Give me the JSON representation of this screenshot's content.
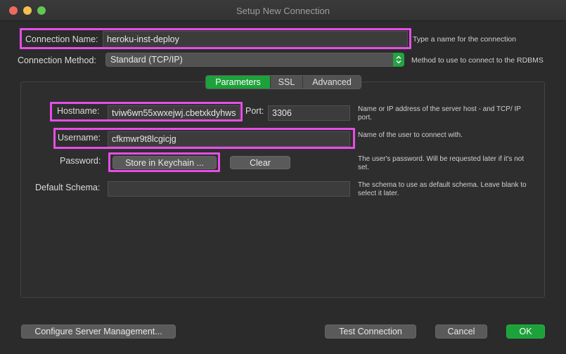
{
  "window": {
    "title": "Setup New Connection"
  },
  "connection_name": {
    "label": "Connection Name:",
    "value": "heroku-inst-deploy",
    "help": "Type a name for the connection"
  },
  "connection_method": {
    "label": "Connection Method:",
    "value": "Standard (TCP/IP)",
    "help": "Method to use to connect to the RDBMS"
  },
  "tabs": [
    {
      "label": "Parameters",
      "active": true
    },
    {
      "label": "SSL",
      "active": false
    },
    {
      "label": "Advanced",
      "active": false
    }
  ],
  "parameters": {
    "hostname": {
      "label": "Hostname:",
      "value": "tviw6wn55xwxejwj.cbetxkdyhws",
      "help": "Name or IP address of the server host - and TCP/ IP port."
    },
    "port": {
      "label": "Port:",
      "value": "3306"
    },
    "username": {
      "label": "Username:",
      "value": "cfkmwr9t8lcgicjg",
      "help": "Name of the user to connect with."
    },
    "password": {
      "label": "Password:",
      "store_button": "Store in Keychain ...",
      "clear_button": "Clear",
      "help": "The user's password. Will be requested later if it's not set."
    },
    "default_schema": {
      "label": "Default Schema:",
      "value": "",
      "help": "The schema to use as default schema. Leave blank to select it later."
    }
  },
  "footer": {
    "configure_button": "Configure Server Management...",
    "test_button": "Test Connection",
    "cancel_button": "Cancel",
    "ok_button": "OK"
  },
  "colors": {
    "accent_green": "#1da13a",
    "highlight_magenta": "#e64ee6",
    "background": "#2b2b2b"
  }
}
